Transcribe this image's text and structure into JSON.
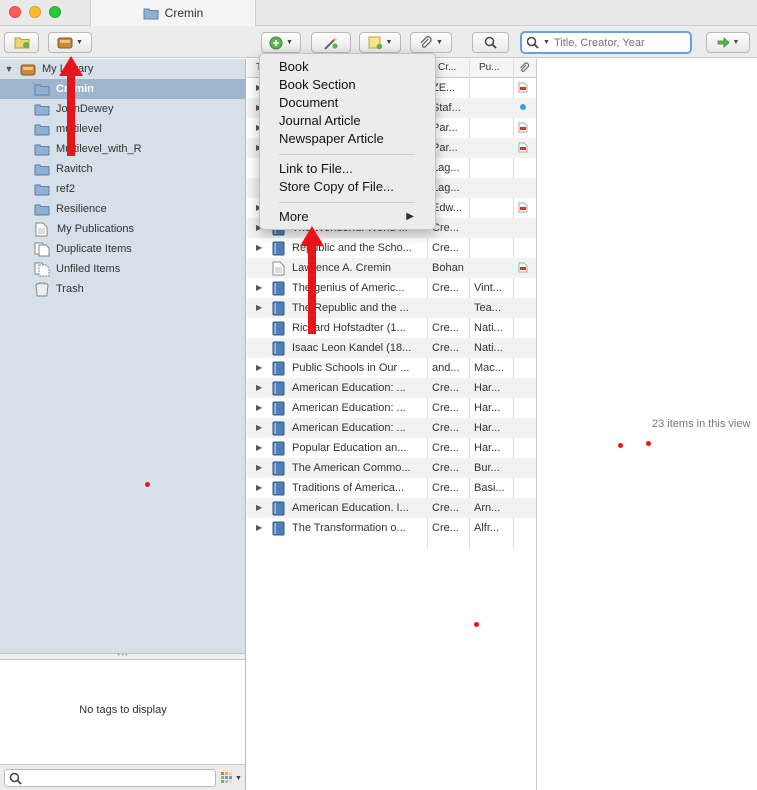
{
  "window": {
    "tab_title": "Cremin"
  },
  "toolbar": {
    "search_placeholder": "Title, Creator, Year"
  },
  "colors": {
    "accent": "#6aa0e8",
    "selection": "#9fb4cd",
    "sidebar_bg": "#d7dfe9",
    "annotation": "#e8141b"
  },
  "sidebar": {
    "root": {
      "label": "My Library",
      "icon": "library-icon"
    },
    "items": [
      {
        "label": "Cremin",
        "icon": "folder-icon",
        "selected": true
      },
      {
        "label": "JohnDewey",
        "icon": "folder-icon"
      },
      {
        "label": "multilevel",
        "icon": "folder-icon"
      },
      {
        "label": "Multilevel_with_R",
        "icon": "folder-icon"
      },
      {
        "label": "Ravitch",
        "icon": "folder-icon"
      },
      {
        "label": "ref2",
        "icon": "folder-icon"
      },
      {
        "label": "Resilience",
        "icon": "folder-icon"
      },
      {
        "label": "My Publications",
        "icon": "document-icon"
      },
      {
        "label": "Duplicate Items",
        "icon": "duplicate-icon"
      },
      {
        "label": "Unfiled Items",
        "icon": "unfiled-icon"
      },
      {
        "label": "Trash",
        "icon": "trash-icon"
      }
    ],
    "tags_empty": "No tags to display"
  },
  "items_list": {
    "columns": {
      "title": "T",
      "creator": "Cr...",
      "publisher": "Pu...",
      "attachments": "paperclip-icon"
    },
    "rows": [
      {
        "title": "",
        "creator": "ZE...",
        "publisher": "",
        "expandable": true,
        "attachment": "pdf"
      },
      {
        "title": "",
        "creator": "Staf...",
        "publisher": "",
        "expandable": true,
        "attachment": "dot"
      },
      {
        "title": "",
        "creator": "Par...",
        "publisher": "",
        "expandable": true,
        "attachment": "pdf"
      },
      {
        "title": "",
        "creator": "Par...",
        "publisher": "",
        "expandable": true,
        "attachment": "pdf"
      },
      {
        "title": "",
        "creator": "Lag...",
        "publisher": "",
        "expandable": false,
        "attachment": ""
      },
      {
        "title": "",
        "creator": "Lag...",
        "publisher": "",
        "expandable": false,
        "attachment": ""
      },
      {
        "title": "",
        "creator": "Edw...",
        "publisher": "",
        "expandable": true,
        "attachment": "pdf"
      },
      {
        "title": "The Wonderful World ...",
        "creator": "Cre...",
        "publisher": "",
        "expandable": true,
        "attachment": ""
      },
      {
        "title": "Republic and the Scho...",
        "creator": "Cre...",
        "publisher": "",
        "expandable": true,
        "attachment": ""
      },
      {
        "title": "Lawrence A. Cremin",
        "creator": "Bohan",
        "publisher": "",
        "expandable": false,
        "attachment": "pdf",
        "type": "document"
      },
      {
        "title": "The genius of Americ...",
        "creator": "Cre...",
        "publisher": "Vint...",
        "expandable": true,
        "attachment": ""
      },
      {
        "title": "The Republic and the ...",
        "creator": "",
        "publisher": "Tea...",
        "expandable": true,
        "attachment": ""
      },
      {
        "title": "Richard Hofstadter (1...",
        "creator": "Cre...",
        "publisher": "Nati...",
        "expandable": false,
        "attachment": ""
      },
      {
        "title": "Isaac Leon Kandel (18...",
        "creator": "Cre...",
        "publisher": "Nati...",
        "expandable": false,
        "attachment": ""
      },
      {
        "title": "Public Schools in Our ...",
        "creator": "and...",
        "publisher": "Mac...",
        "expandable": true,
        "attachment": ""
      },
      {
        "title": "American Education: ...",
        "creator": "Cre...",
        "publisher": "Har...",
        "expandable": true,
        "attachment": ""
      },
      {
        "title": "American Education: ...",
        "creator": "Cre...",
        "publisher": "Har...",
        "expandable": true,
        "attachment": ""
      },
      {
        "title": "American Education: ...",
        "creator": "Cre...",
        "publisher": "Har...",
        "expandable": true,
        "attachment": ""
      },
      {
        "title": "Popular Education an...",
        "creator": "Cre...",
        "publisher": "Har...",
        "expandable": true,
        "attachment": ""
      },
      {
        "title": "The American Commo...",
        "creator": "Cre...",
        "publisher": "Bur...",
        "expandable": true,
        "attachment": ""
      },
      {
        "title": "Traditions of America...",
        "creator": "Cre...",
        "publisher": "Basi...",
        "expandable": true,
        "attachment": ""
      },
      {
        "title": "American Education. I...",
        "creator": "Cre...",
        "publisher": "Arn...",
        "expandable": true,
        "attachment": ""
      },
      {
        "title": "The Transformation o...",
        "creator": "Cre...",
        "publisher": "Alfr...",
        "expandable": true,
        "attachment": ""
      }
    ]
  },
  "item_pane": {
    "count_text": "23 items in this view"
  },
  "new_item_menu": {
    "group1": [
      "Book",
      "Book Section",
      "Document",
      "Journal Article",
      "Newspaper Article"
    ],
    "group2": [
      "Link to File...",
      "Store Copy of File..."
    ],
    "more": "More"
  }
}
